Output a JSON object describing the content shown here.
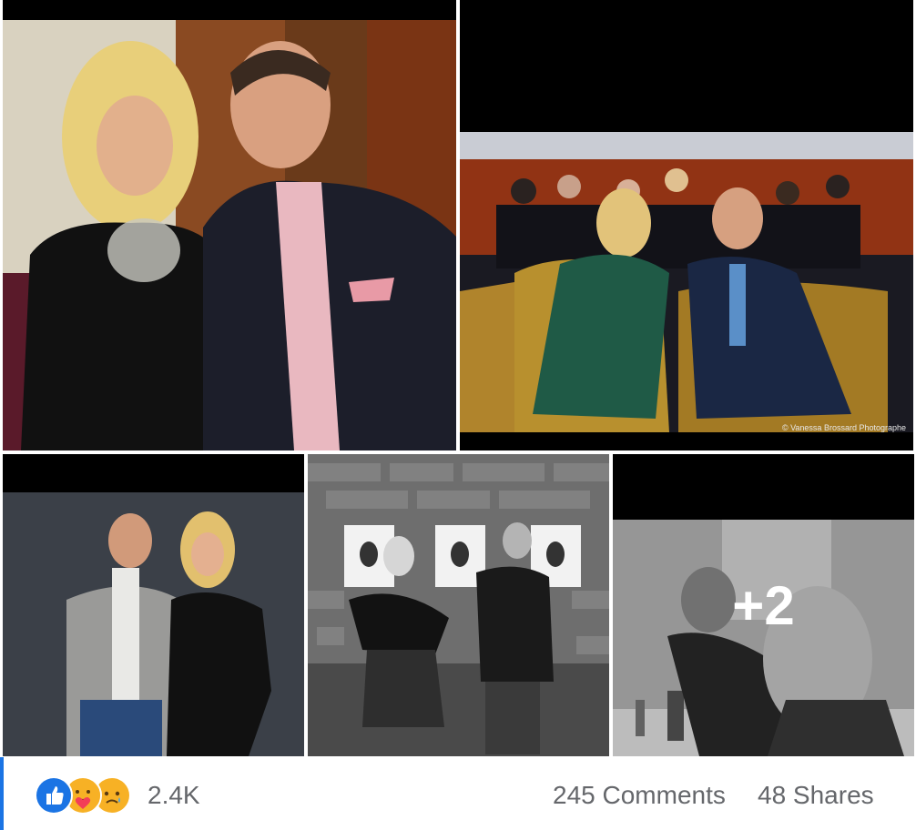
{
  "post": {
    "photos": [
      {
        "name": "photo-tv-studio-duo"
      },
      {
        "name": "photo-audience-armchairs",
        "credit": "© Vanessa Brossard Photographe"
      },
      {
        "name": "photo-studio-portrait"
      },
      {
        "name": "photo-brick-wall-bw"
      },
      {
        "name": "photo-makeup-room-bw",
        "more_label": "+2"
      }
    ],
    "reactions": {
      "icons": [
        "like-icon",
        "care-icon",
        "sad-icon"
      ],
      "count": "2.4K"
    },
    "comments_label": "245 Comments",
    "shares_label": "48 Shares"
  },
  "colors": {
    "like_blue": "#1b74e4",
    "care_yellow": "#f7b125",
    "meta_gray": "#65676b"
  }
}
